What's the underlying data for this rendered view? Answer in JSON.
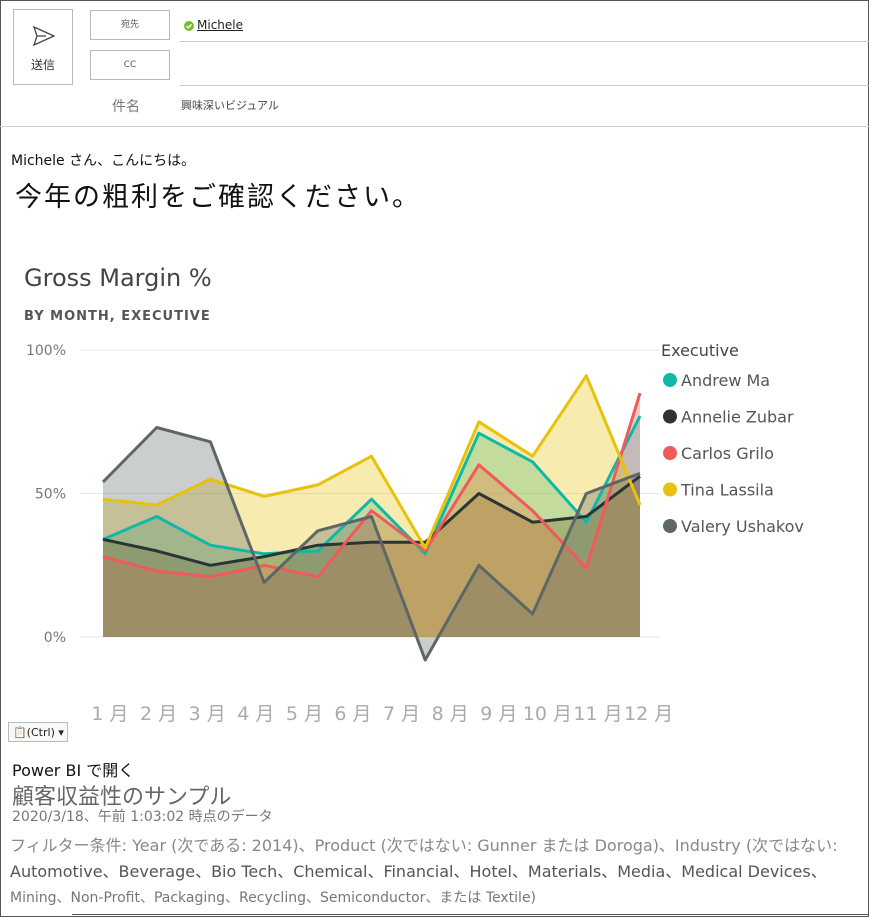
{
  "compose": {
    "send_label": "送信",
    "to_label": "宛先",
    "cc_label": "CC",
    "recipient": "Michele",
    "subject_label": "件名",
    "subject_value": "興味深いビジュアル"
  },
  "body": {
    "greeting": "Michele さん、こんにちは。",
    "headline": "今年の粗利をご確認ください。"
  },
  "chart_data": {
    "type": "area",
    "title": "Gross Margin %",
    "subtitle": "BY MONTH, EXECUTIVE",
    "categories": [
      "1 月",
      "2 月",
      "3 月",
      "4 月",
      "5 月",
      "6 月",
      "7 月",
      "8 月",
      "9 月",
      "10 月",
      "11 月",
      "12 月"
    ],
    "y_ticks": [
      "100%",
      "50%",
      "0%"
    ],
    "ylim": [
      0,
      100
    ],
    "legend_title": "Executive",
    "legend_position": "right",
    "series": [
      {
        "name": "Andrew Ma",
        "color": "#10b8a8",
        "values": [
          34,
          42,
          32,
          29,
          30,
          48,
          29,
          71,
          61,
          40,
          77
        ]
      },
      {
        "name": "Annelie Zubar",
        "color": "#2b3535",
        "values": [
          34,
          30,
          25,
          28,
          32,
          33,
          33,
          50,
          40,
          42,
          56
        ]
      },
      {
        "name": "Carlos Grilo",
        "color": "#f05a5a",
        "values": [
          28,
          23,
          21,
          25,
          21,
          44,
          30,
          60,
          44,
          24,
          85
        ]
      },
      {
        "name": "Tina Lassila",
        "color": "#e8c20a",
        "values": [
          48,
          46,
          55,
          49,
          53,
          63,
          31,
          75,
          63,
          91,
          46
        ]
      },
      {
        "name": "Valery Ushakov",
        "color": "#5d6767",
        "values": [
          54,
          73,
          68,
          19,
          37,
          42,
          -8,
          25,
          8,
          50,
          57
        ]
      }
    ]
  },
  "footer": {
    "paste_label": "(Ctrl)",
    "open_in_pbi": "Power BI で開く",
    "report_name": "顧客収益性のサンプル",
    "report_date": "2020/3/18、午前 1:03:02 時点のデータ",
    "filters_line1": "フィルター条件: Year (次である: 2014)、Product (次ではない: Gunner または Doroga)、Industry (次ではない: ",
    "filters_line2": "Automotive、Beverage、Bio Tech、Chemical、Financial、Hotel、Materials、Media、Medical Devices、",
    "filters_line3": "Mining、Non-Profit、Packaging、Recycling、Semiconductor、または Textile)"
  }
}
